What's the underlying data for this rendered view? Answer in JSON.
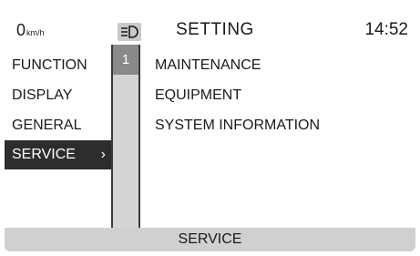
{
  "header": {
    "speed_value": "0",
    "speed_unit": "km/h",
    "lamp_icon": "headlight-icon",
    "title": "SETTING",
    "clock": "14:52"
  },
  "left_menu": {
    "items": [
      {
        "label": "FUNCTION"
      },
      {
        "label": "DISPLAY"
      },
      {
        "label": "GENERAL"
      },
      {
        "label": "SERVICE",
        "selected": true,
        "chevron": "›"
      }
    ]
  },
  "scrollbar": {
    "page_indicator": "1"
  },
  "right_menu": {
    "items": [
      {
        "label": "MAINTENANCE"
      },
      {
        "label": "EQUIPMENT"
      },
      {
        "label": "SYSTEM INFORMATION"
      }
    ]
  },
  "footer": {
    "label": "SERVICE"
  },
  "colors": {
    "selected_bg": "#2d2d2d",
    "rail_bg": "#d4d4d4",
    "thumb_bg": "#8a8a8a",
    "footer_bg": "#d0d0d0",
    "lamp_bg": "#c9c9c9"
  }
}
